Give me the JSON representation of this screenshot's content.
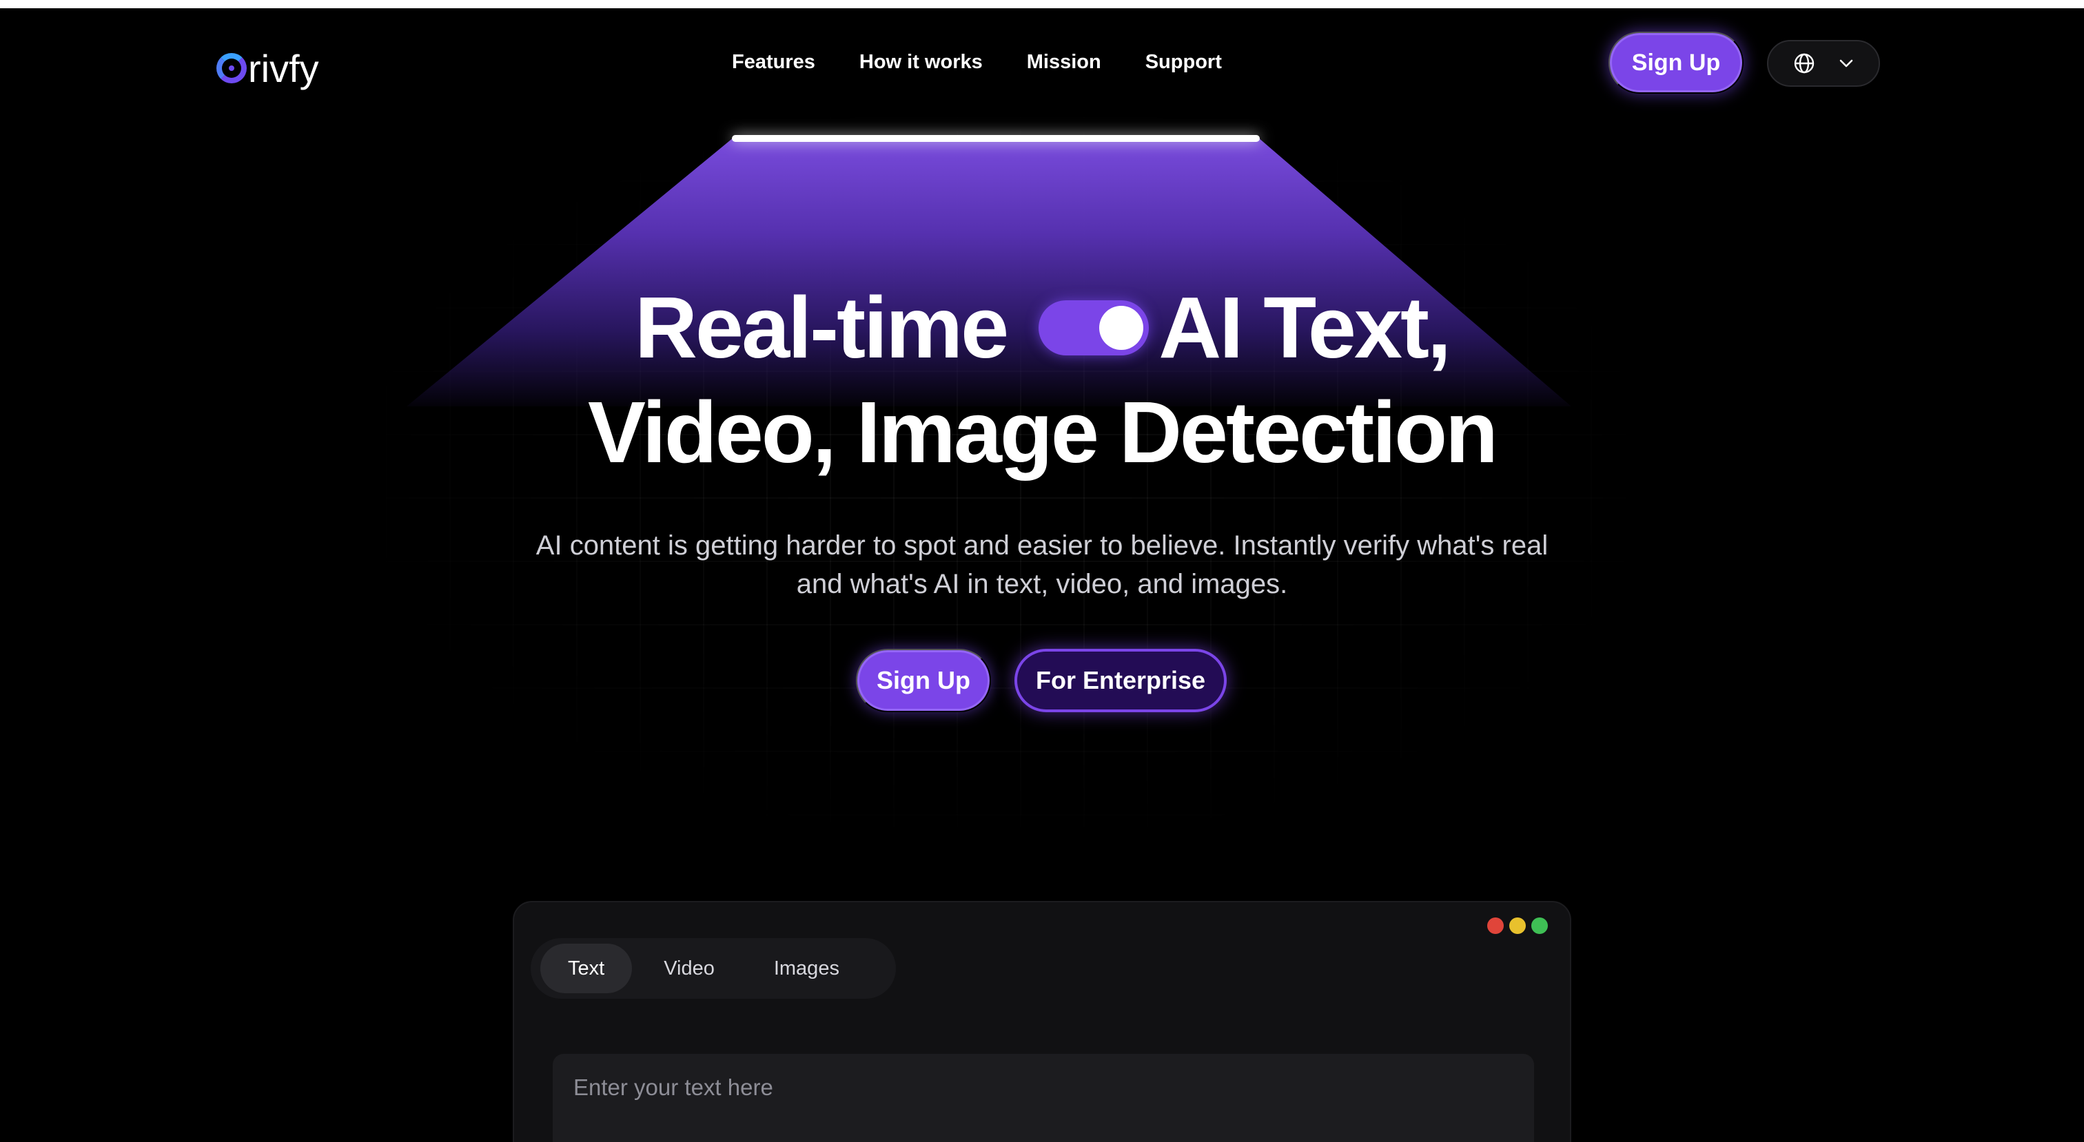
{
  "brand": {
    "logo_text": "rivfy"
  },
  "nav": {
    "links": [
      "Features",
      "How it works",
      "Mission",
      "Support"
    ],
    "signup_label": "Sign Up"
  },
  "hero": {
    "title_line1_part1": "Real-time",
    "title_line1_part2": "AI Text,",
    "title_line2": "Video, Image Detection",
    "subtitle": "AI content is getting harder to spot and easier to believe. Instantly verify what's real and what's AI in text, video, and images.",
    "cta_signup": "Sign Up",
    "cta_enterprise": "For Enterprise"
  },
  "demo": {
    "tabs": [
      "Text",
      "Video",
      "Images"
    ],
    "active_tab": "Text",
    "input_placeholder": "Enter your text here"
  },
  "colors": {
    "accent": "#7b45e8",
    "background": "#000000",
    "dot_red": "#e0453a",
    "dot_yellow": "#e8c12d",
    "dot_green": "#3fbf55"
  },
  "icons": {
    "globe": "globe-icon",
    "chevron": "chevron-down-icon"
  }
}
